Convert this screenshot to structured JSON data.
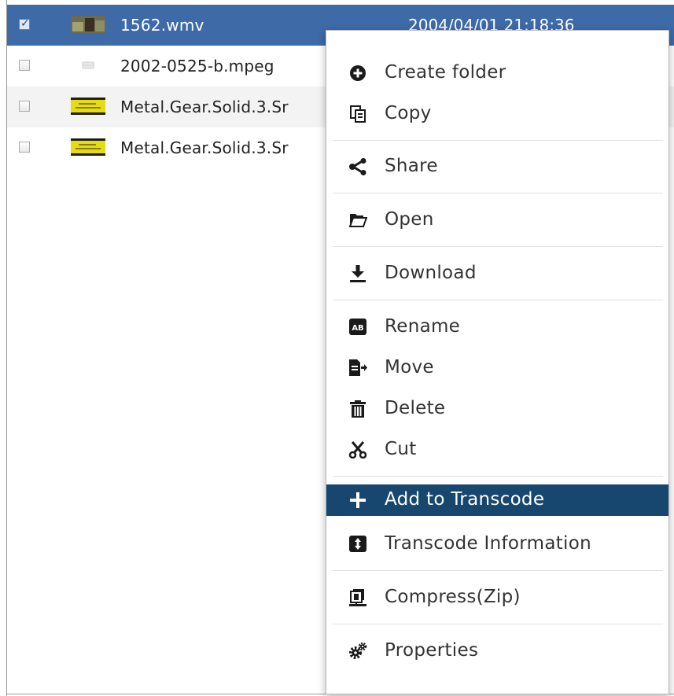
{
  "files": [
    {
      "name": "1562.wmv",
      "modified": "2004/04/01 21:18:36",
      "checked": true,
      "selected": true,
      "thumb": "video-thumbnail"
    },
    {
      "name": "2002-0525-b.mpeg",
      "modified": "",
      "checked": false,
      "selected": false,
      "thumb": "video-placeholder"
    },
    {
      "name": "Metal.Gear.Solid.3.Sr",
      "modified": "",
      "checked": false,
      "selected": false,
      "thumb": "yellow-video-thumbnail"
    },
    {
      "name": "Metal.Gear.Solid.3.Sr",
      "modified": "",
      "checked": false,
      "selected": false,
      "thumb": "yellow-video-thumbnail"
    }
  ],
  "context_menu": {
    "items": [
      {
        "label": "Create folder",
        "icon": "plus-circle-icon"
      },
      {
        "label": "Copy",
        "icon": "copy-icon"
      },
      {
        "label": "Share",
        "icon": "share-icon"
      },
      {
        "label": "Open",
        "icon": "folder-open-icon"
      },
      {
        "label": "Download",
        "icon": "download-icon"
      },
      {
        "label": "Rename",
        "icon": "rename-ab-icon"
      },
      {
        "label": "Move",
        "icon": "move-icon"
      },
      {
        "label": "Delete",
        "icon": "trash-icon"
      },
      {
        "label": "Cut",
        "icon": "scissors-icon"
      },
      {
        "label": "Add to Transcode",
        "icon": "plus-icon",
        "active": true
      },
      {
        "label": "Transcode Information",
        "icon": "transcode-info-icon"
      },
      {
        "label": "Compress(Zip)",
        "icon": "compress-icon"
      },
      {
        "label": "Properties",
        "icon": "gears-icon"
      }
    ]
  },
  "colors": {
    "selected_row": "#3e6aa8",
    "active_menu_item": "#17466e",
    "menu_text": "#333333"
  }
}
